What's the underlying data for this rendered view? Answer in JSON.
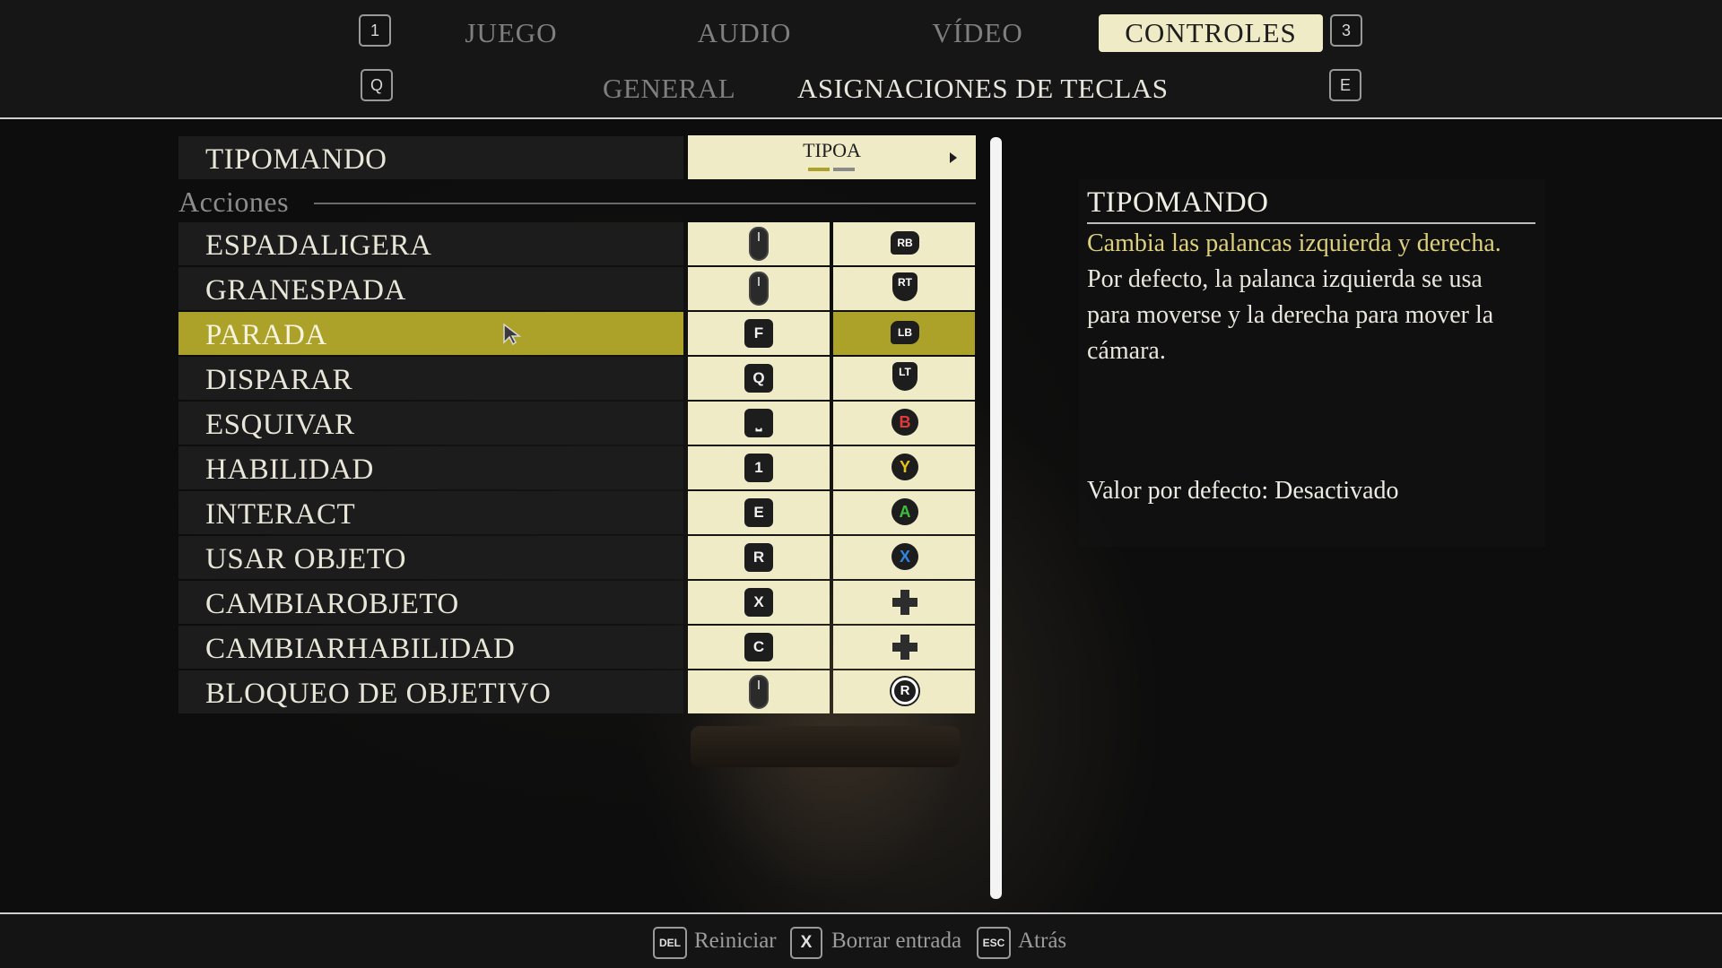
{
  "header": {
    "keys": {
      "prev_tab": "1",
      "next_tab": "3",
      "prev_sub": "Q",
      "next_sub": "E"
    },
    "tabs": [
      {
        "label": "JUEGO",
        "active": false
      },
      {
        "label": "AUDIO",
        "active": false
      },
      {
        "label": "VÍDEO",
        "active": false
      },
      {
        "label": "CONTROLES",
        "active": true
      }
    ],
    "subtabs": [
      {
        "label": "GENERAL",
        "active": false
      },
      {
        "label": "ASIGNACIONES DE TECLAS",
        "active": true
      }
    ]
  },
  "controller_setting": {
    "label": "TIPOMANDO",
    "value": "TIPOA",
    "option_index": 1,
    "option_count": 2
  },
  "section": {
    "label": "Acciones"
  },
  "actions": [
    {
      "label": "ESPADALIGERA",
      "keyboard": "mouse-left",
      "keyboard_icon": "mouse-left-click-icon",
      "gamepad": "RB",
      "gamepad_icon": "rb-button-icon"
    },
    {
      "label": "GRANESPADA",
      "keyboard": "mouse-right",
      "keyboard_icon": "mouse-right-click-icon",
      "gamepad": "RT",
      "gamepad_icon": "rt-trigger-icon"
    },
    {
      "label": "PARADA",
      "keyboard": "F",
      "keyboard_icon": "f-key-icon",
      "gamepad": "LB",
      "gamepad_icon": "lb-button-icon",
      "selected": true
    },
    {
      "label": "DISPARAR",
      "keyboard": "Q",
      "keyboard_icon": "q-key-icon",
      "gamepad": "LT",
      "gamepad_icon": "lt-trigger-icon"
    },
    {
      "label": "ESQUIVAR",
      "keyboard": "⎵",
      "keyboard_icon": "space-key-icon",
      "gamepad": "B",
      "gamepad_icon": "b-button-icon",
      "gamepad_color": "#e03a3a"
    },
    {
      "label": "HABILIDAD",
      "keyboard": "1",
      "keyboard_icon": "1-key-icon",
      "gamepad": "Y",
      "gamepad_icon": "y-button-icon",
      "gamepad_color": "#e8c21c"
    },
    {
      "label": "INTERACT",
      "keyboard": "E",
      "keyboard_icon": "e-key-icon",
      "gamepad": "A",
      "gamepad_icon": "a-button-icon",
      "gamepad_color": "#3fbf3f"
    },
    {
      "label": "USAR OBJETO",
      "keyboard": "R",
      "keyboard_icon": "r-key-icon",
      "gamepad": "X",
      "gamepad_icon": "x-button-icon",
      "gamepad_color": "#2f86e0"
    },
    {
      "label": "CAMBIAROBJETO",
      "keyboard": "X",
      "keyboard_icon": "x-key-icon",
      "gamepad": "dpad-down",
      "gamepad_icon": "dpad-down-icon"
    },
    {
      "label": "CAMBIARHABILIDAD",
      "keyboard": "C",
      "keyboard_icon": "c-key-icon",
      "gamepad": "dpad-up",
      "gamepad_icon": "dpad-up-icon"
    },
    {
      "label": "BLOQUEO DE OBJETIVO",
      "keyboard": "mouse-middle",
      "keyboard_icon": "mouse-middle-click-icon",
      "gamepad": "R",
      "gamepad_icon": "right-stick-click-icon"
    }
  ],
  "description": {
    "title": "TIPOMANDO",
    "highlight": "Cambia las palancas izquierda y derecha.",
    "body": " Por defecto, la palanca izquierda se usa para moverse y la derecha para mover la cámara.",
    "default_value": "Valor por defecto: Desactivado"
  },
  "footer": [
    {
      "key": "DEL",
      "label": "Reiniciar"
    },
    {
      "key": "X",
      "label": "Borrar entrada"
    },
    {
      "key": "ESC",
      "label": "Atrás"
    }
  ],
  "colors": {
    "accent": "#aca22a",
    "cell": "#efebc6",
    "row": "#1c1c1c",
    "highlight_text": "#ddd07a"
  }
}
